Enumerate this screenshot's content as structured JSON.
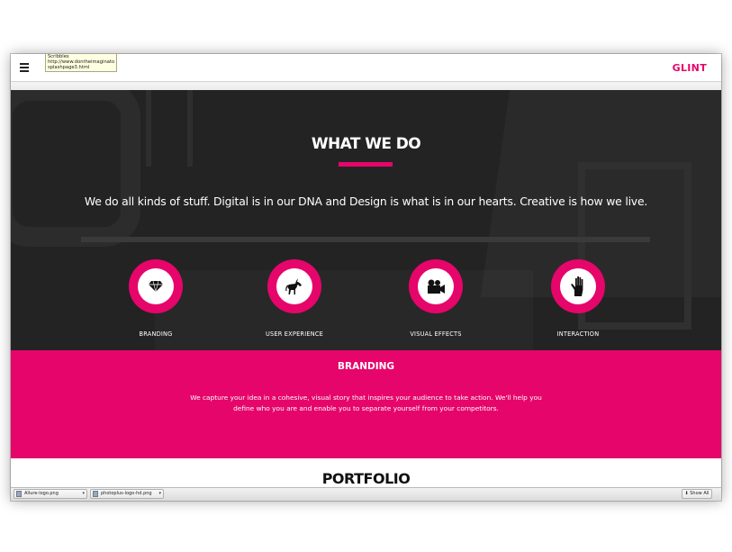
{
  "header": {
    "brand": "GLINT",
    "tooltip": {
      "line1": "Scribbles",
      "line2": "http://www.dontheimaginator.com/",
      "line3": "splashpage3.html"
    }
  },
  "hero": {
    "title": "WHAT WE DO",
    "text": "We do all kinds of stuff. Digital is in our DNA and Design is what is in our hearts. Creative is how we live.",
    "services": [
      {
        "label": "BRANDING",
        "icon": "diamond-icon"
      },
      {
        "label": "USER EXPERIENCE",
        "icon": "unicorn-icon"
      },
      {
        "label": "VISUAL EFFECTS",
        "icon": "video-camera-icon"
      },
      {
        "label": "INTERACTION",
        "icon": "hand-icon"
      }
    ]
  },
  "branding": {
    "title": "BRANDING",
    "text": "We capture your idea in a cohesive, visual story that inspires your audience to take action. We'll help you define who you are and enable you to separate yourself from your competitors."
  },
  "portfolio": {
    "title": "PORTFOLIO"
  },
  "downloads": {
    "items": [
      "Allure-logo.png",
      "photoplus-logo-hd.png"
    ],
    "show_all": "Show All"
  },
  "colors": {
    "accent": "#e6056a",
    "dark": "#232323"
  }
}
